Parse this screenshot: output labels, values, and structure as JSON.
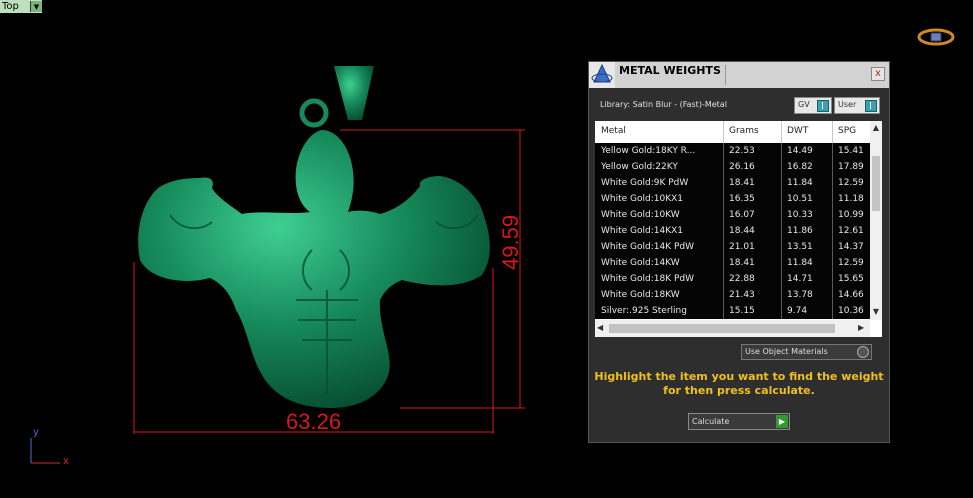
{
  "viewport": {
    "view_name": "Top",
    "dimension_width": "63.26",
    "dimension_height": "49.59",
    "axis_y": "y",
    "axis_x": "x"
  },
  "panel": {
    "title": "METAL WEIGHTS",
    "close_label": "x",
    "library": "Library: Satin Blur - (Fast)-Metal",
    "gv_label": "GV",
    "user_label": "User",
    "columns": [
      "Metal",
      "Grams",
      "DWT",
      "SPG"
    ],
    "rows": [
      {
        "metal": "Yellow Gold:18KY R...",
        "grams": "22.53",
        "dwt": "14.49",
        "spg": "15.41"
      },
      {
        "metal": "Yellow Gold:22KY",
        "grams": "26.16",
        "dwt": "16.82",
        "spg": "17.89"
      },
      {
        "metal": "White Gold:9K PdW",
        "grams": "18.41",
        "dwt": "11.84",
        "spg": "12.59"
      },
      {
        "metal": "White Gold:10KX1",
        "grams": "16.35",
        "dwt": "10.51",
        "spg": "11.18"
      },
      {
        "metal": "White Gold:10KW",
        "grams": "16.07",
        "dwt": "10.33",
        "spg": "10.99"
      },
      {
        "metal": "White Gold:14KX1",
        "grams": "18.44",
        "dwt": "11.86",
        "spg": "12.61"
      },
      {
        "metal": "White Gold:14K PdW",
        "grams": "21.01",
        "dwt": "13.51",
        "spg": "14.37"
      },
      {
        "metal": "White Gold:14KW",
        "grams": "18.41",
        "dwt": "11.84",
        "spg": "12.59"
      },
      {
        "metal": "White Gold:18K PdW",
        "grams": "22.88",
        "dwt": "14.71",
        "spg": "15.65"
      },
      {
        "metal": "White Gold:18KW",
        "grams": "21.43",
        "dwt": "13.78",
        "spg": "14.66"
      },
      {
        "metal": "Silver:.925 Sterling",
        "grams": "15.15",
        "dwt": "9.74",
        "spg": "10.36"
      }
    ],
    "use_object_materials": "Use Object Materials",
    "hint_line1": "Highlight the item you want to find the weight",
    "hint_line2": "for then press calculate.",
    "calculate_label": "Calculate"
  },
  "colors": {
    "model": "#1a8a5c",
    "dimension": "#d81818",
    "hint": "#f0c020",
    "calc_go": "#2f9a2f"
  }
}
